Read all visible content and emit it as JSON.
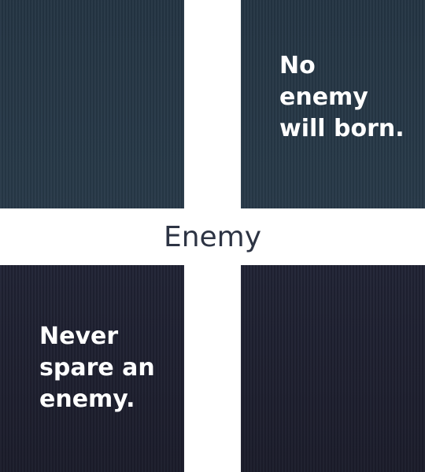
{
  "quadrants": {
    "top_right_text": "No\nenemy\nwill born.",
    "bottom_left_text": "Never\nspare an\nenemy."
  },
  "center_label": "Enemy",
  "colors": {
    "panel_top": "#263746",
    "panel_bottom": "#1f2233",
    "divider": "#ffffff",
    "label_text": "#2d3444"
  }
}
